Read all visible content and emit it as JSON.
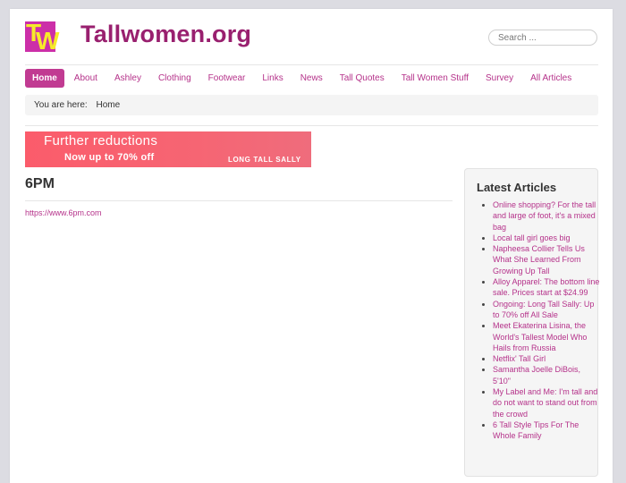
{
  "header": {
    "logo_text_t": "T",
    "logo_text_w": "W",
    "site_title": "Tallwomen.org",
    "search_placeholder": "Search ..."
  },
  "nav": [
    {
      "label": "Home",
      "active": true
    },
    {
      "label": "About"
    },
    {
      "label": "Ashley"
    },
    {
      "label": "Clothing"
    },
    {
      "label": "Footwear"
    },
    {
      "label": "Links"
    },
    {
      "label": "News"
    },
    {
      "label": "Tall Quotes"
    },
    {
      "label": "Tall Women Stuff"
    },
    {
      "label": "Survey"
    },
    {
      "label": "All Articles"
    }
  ],
  "breadcrumb": {
    "prefix": "You are here:",
    "current": "Home"
  },
  "banner": {
    "line1": "Further reductions",
    "line2": "Now up to 70% off",
    "brand": "LONG TALL SALLY"
  },
  "article": {
    "title": "6PM",
    "link": "https://www.6pm.com"
  },
  "sidebar": {
    "title": "Latest Articles",
    "items": [
      "Online shopping? For the tall and large of foot, it's a mixed bag",
      "Local tall girl goes big",
      "Napheesa Collier Tells Us What She Learned From Growing Up Tall",
      "Alloy Apparel: The bottom line sale. Prices start at $24.99",
      "Ongoing: Long Tall Sally: Up to 70% off All Sale",
      "Meet Ekaterina Lisina, the World's Tallest Model Who Hails from Russia",
      "Netflix' Tall Girl",
      "Samantha Joelle DiBois, 5'10\"",
      "My Label and Me: I'm tall and do not want to stand out from the crowd",
      "6 Tall Style Tips For The Whole Family"
    ]
  },
  "colors": {
    "accent": "#c13b92",
    "link": "#b5328a",
    "title": "#99206f",
    "logo_bg": "#cc2fa8",
    "logo_fg": "#f6ea2a"
  }
}
